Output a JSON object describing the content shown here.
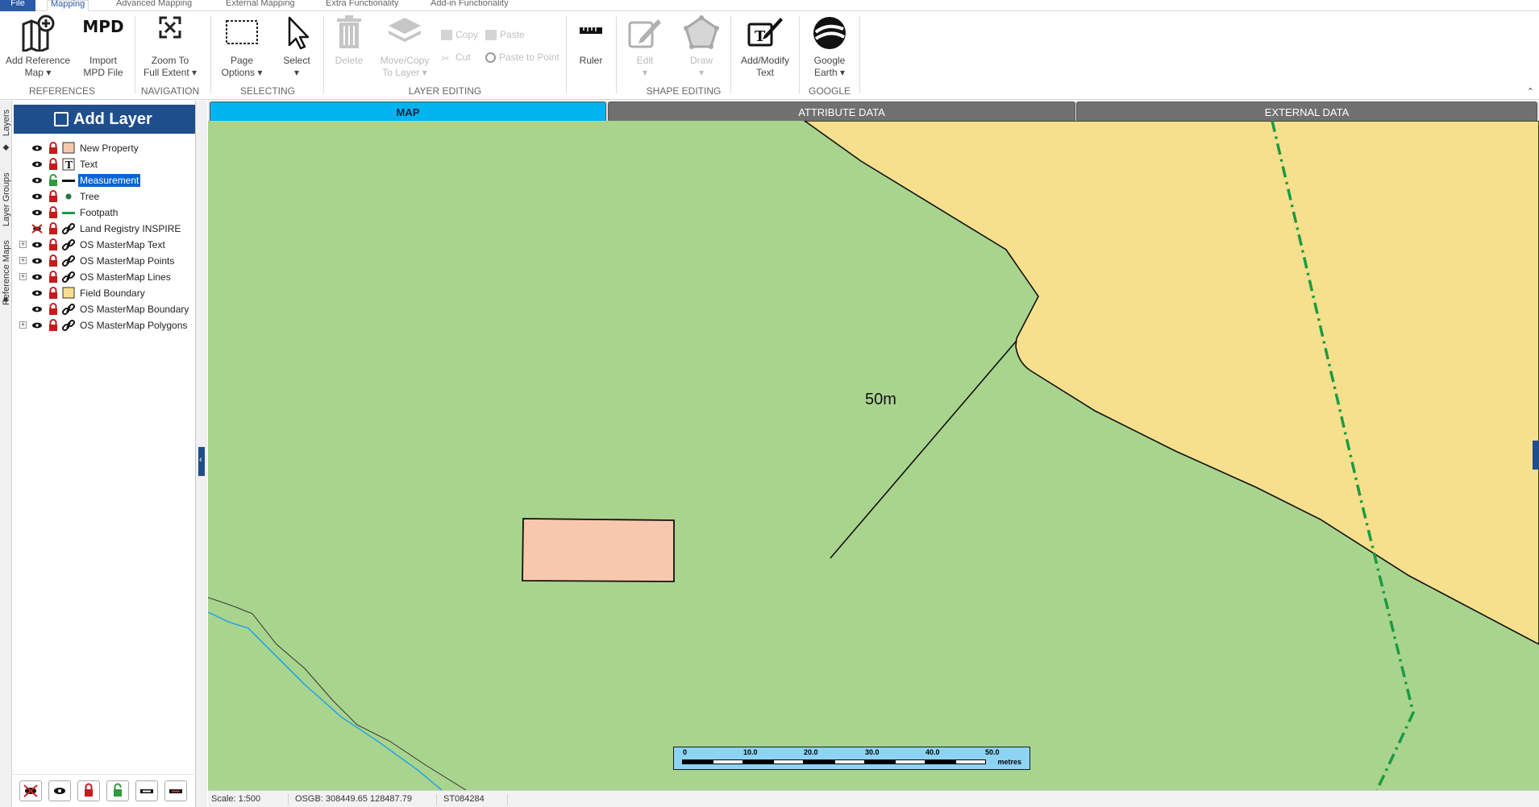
{
  "menu": {
    "tabs": [
      "File",
      "Mapping",
      "Advanced Mapping",
      "External Mapping",
      "Extra Functionality",
      "Add-in Functionality"
    ]
  },
  "ribbon": {
    "add_reference_map": [
      "Add Reference",
      "Map ▾"
    ],
    "import_mpd": [
      "Import",
      "MPD File"
    ],
    "mpd_icon_text": "MPD",
    "zoom_full_extent": [
      "Zoom To",
      "Full Extent ▾"
    ],
    "page_options": [
      "Page",
      "Options ▾"
    ],
    "select": [
      "Select",
      "▾"
    ],
    "delete": "Delete",
    "move_copy": [
      "Move/Copy",
      "To Layer ▾"
    ],
    "copy": "Copy",
    "paste": "Paste",
    "cut": "Cut",
    "paste_to_point": "Paste to Point",
    "ruler": "Ruler",
    "edit": [
      "Edit",
      "▾"
    ],
    "draw": [
      "Draw",
      "▾"
    ],
    "add_modify_text": [
      "Add/Modify",
      "Text"
    ],
    "google_earth": [
      "Google",
      "Earth ▾"
    ],
    "groups": {
      "references": "REFERENCES",
      "navigation": "NAVIGATION",
      "selecting": "SELECTING",
      "layer_editing": "LAYER EDITING",
      "shape_editing": "SHAPE EDITING",
      "google": "GOOGLE"
    }
  },
  "vertical_tabs": [
    "Layers",
    "Layer Groups",
    "Reference Maps"
  ],
  "layers_panel": {
    "add_layer": "Add Layer",
    "layers": [
      {
        "name": "New Property",
        "expandable": false,
        "visible": true,
        "locked": true,
        "symbol": "fill-salmon",
        "selected": false
      },
      {
        "name": "Text",
        "expandable": false,
        "visible": true,
        "locked": true,
        "symbol": "text",
        "selected": false
      },
      {
        "name": "Measurement",
        "expandable": false,
        "visible": true,
        "locked": false,
        "symbol": "line-black",
        "selected": true
      },
      {
        "name": "Tree",
        "expandable": false,
        "visible": true,
        "locked": true,
        "symbol": "point-green",
        "selected": false
      },
      {
        "name": "Footpath",
        "expandable": false,
        "visible": true,
        "locked": true,
        "symbol": "line-green",
        "selected": false
      },
      {
        "name": "Land Registry INSPIRE",
        "expandable": false,
        "visible": false,
        "locked": true,
        "symbol": "link",
        "selected": false
      },
      {
        "name": "OS MasterMap Text",
        "expandable": true,
        "visible": true,
        "locked": true,
        "symbol": "link",
        "selected": false
      },
      {
        "name": "OS MasterMap Points",
        "expandable": true,
        "visible": true,
        "locked": true,
        "symbol": "link",
        "selected": false
      },
      {
        "name": "OS MasterMap Lines",
        "expandable": true,
        "visible": true,
        "locked": true,
        "symbol": "link",
        "selected": false
      },
      {
        "name": "Field Boundary",
        "expandable": false,
        "visible": true,
        "locked": true,
        "symbol": "fill-yellow",
        "selected": false
      },
      {
        "name": "OS MasterMap Boundary",
        "expandable": false,
        "visible": true,
        "locked": true,
        "symbol": "link",
        "selected": false
      },
      {
        "name": "OS MasterMap Polygons",
        "expandable": true,
        "visible": true,
        "locked": true,
        "symbol": "link",
        "selected": false
      }
    ],
    "toolbar_icons": [
      "hide-all-icon",
      "show-all-icon",
      "lock-all-icon",
      "unlock-all-icon",
      "label-off-icon",
      "label-on-icon"
    ]
  },
  "content_tabs": [
    "MAP",
    "ATTRIBUTE DATA",
    "EXTERNAL DATA"
  ],
  "map": {
    "measurement_label": "50m",
    "colors": {
      "field": "#a9d48e",
      "boundary": "#f7e08d",
      "property": "#f8c8ae",
      "footpath": "#1a9a44",
      "stream": "#29a7df"
    },
    "scalebar": {
      "labels": [
        "0",
        "10.0",
        "20.0",
        "30.0",
        "40.0",
        "50.0"
      ],
      "units": "metres"
    }
  },
  "status": {
    "scale": "Scale: 1:500",
    "coords": "OSGB: 308449.65  128487.79",
    "grid_ref": "ST084284"
  }
}
